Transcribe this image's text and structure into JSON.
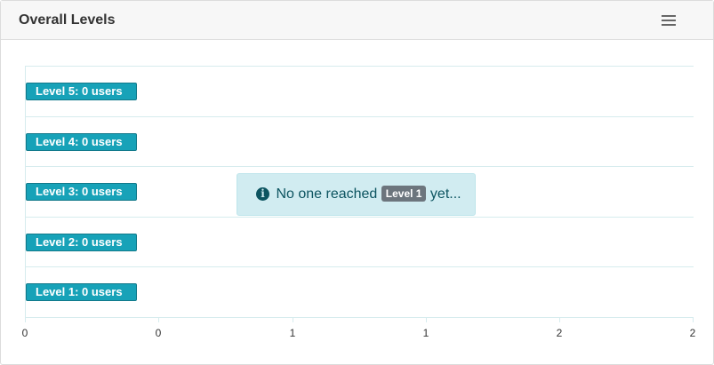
{
  "card": {
    "title": "Overall Levels",
    "menu_icon": "hamburger-menu-icon"
  },
  "levels": [
    {
      "label": "Level 5: 0 users",
      "users": 0
    },
    {
      "label": "Level 4: 0 users",
      "users": 0
    },
    {
      "label": "Level 3: 0 users",
      "users": 0
    },
    {
      "label": "Level 2: 0 users",
      "users": 0
    },
    {
      "label": "Level 1: 0 users",
      "users": 0
    }
  ],
  "x_axis": {
    "tick_labels": [
      "0",
      "0",
      "1",
      "1",
      "2",
      "2"
    ]
  },
  "alert": {
    "icon": "info-circle-icon",
    "text_before": "No one reached",
    "badge": "Level 1",
    "text_after": "yet..."
  },
  "colors": {
    "badge_bg": "#17a2b8",
    "alert_bg": "#d1ecf1",
    "alert_text": "#0c5460",
    "inline_badge_bg": "#6c757d"
  }
}
